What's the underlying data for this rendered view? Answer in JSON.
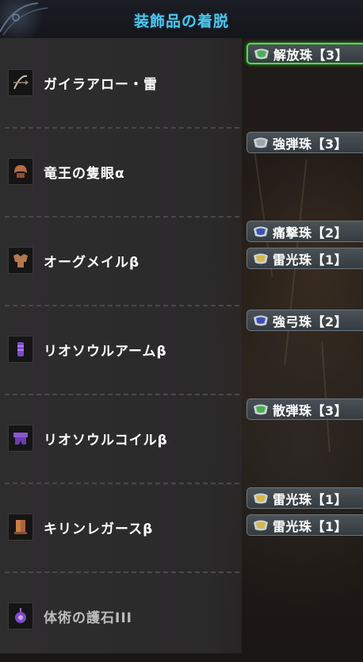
{
  "header": {
    "title": "装飾品の着脱"
  },
  "equipment": [
    {
      "name": "ガイラアロー・雷",
      "icon": "bow-icon",
      "decorations": [
        {
          "label": "解放珠【3】",
          "icon": "jewel-slot-3-icon",
          "color": "#4caf50",
          "selected": true
        }
      ]
    },
    {
      "name": "竜王の隻眼α",
      "icon": "head-armor-icon",
      "decorations": [
        {
          "label": "強弾珠【3】",
          "icon": "jewel-slot-3-icon",
          "color": "#9aa6ad",
          "selected": false
        }
      ]
    },
    {
      "name": "オーグメイルβ",
      "icon": "chest-armor-icon",
      "decorations": [
        {
          "label": "痛撃珠【2】",
          "icon": "jewel-slot-2-icon",
          "color": "#3f51b5",
          "selected": false
        },
        {
          "label": "雷光珠【1】",
          "icon": "jewel-slot-1-icon",
          "color": "#d6b84a",
          "selected": false
        }
      ]
    },
    {
      "name": "リオソウルアームβ",
      "icon": "arm-armor-icon",
      "decorations": [
        {
          "label": "強弓珠【2】",
          "icon": "jewel-slot-2-icon",
          "color": "#3f51b5",
          "selected": false
        }
      ]
    },
    {
      "name": "リオソウルコイルβ",
      "icon": "waist-armor-icon",
      "decorations": [
        {
          "label": "散弾珠【3】",
          "icon": "jewel-slot-3-icon",
          "color": "#4caf50",
          "selected": false
        }
      ]
    },
    {
      "name": "キリンレガースβ",
      "icon": "leg-armor-icon",
      "decorations": [
        {
          "label": "雷光珠【1】",
          "icon": "jewel-slot-1-icon",
          "color": "#d6b84a",
          "selected": false
        },
        {
          "label": "雷光珠【1】",
          "icon": "jewel-slot-1-icon",
          "color": "#d6b84a",
          "selected": false
        }
      ]
    },
    {
      "name": "体術の護石III",
      "icon": "charm-icon",
      "decorations": []
    }
  ]
}
